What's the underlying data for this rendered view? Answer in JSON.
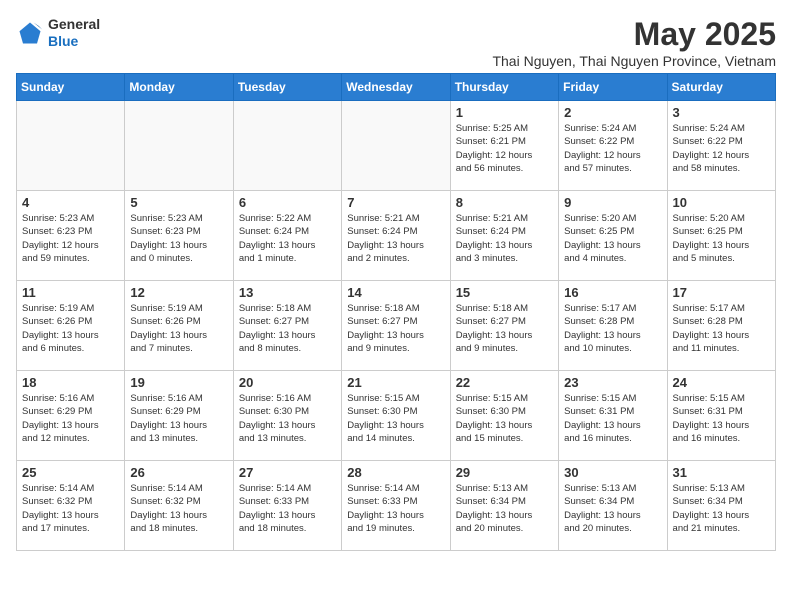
{
  "header": {
    "logo_general": "General",
    "logo_blue": "Blue",
    "month_title": "May 2025",
    "subtitle": "Thai Nguyen, Thai Nguyen Province, Vietnam"
  },
  "weekdays": [
    "Sunday",
    "Monday",
    "Tuesday",
    "Wednesday",
    "Thursday",
    "Friday",
    "Saturday"
  ],
  "weeks": [
    [
      {
        "day": "",
        "info": ""
      },
      {
        "day": "",
        "info": ""
      },
      {
        "day": "",
        "info": ""
      },
      {
        "day": "",
        "info": ""
      },
      {
        "day": "1",
        "info": "Sunrise: 5:25 AM\nSunset: 6:21 PM\nDaylight: 12 hours\nand 56 minutes."
      },
      {
        "day": "2",
        "info": "Sunrise: 5:24 AM\nSunset: 6:22 PM\nDaylight: 12 hours\nand 57 minutes."
      },
      {
        "day": "3",
        "info": "Sunrise: 5:24 AM\nSunset: 6:22 PM\nDaylight: 12 hours\nand 58 minutes."
      }
    ],
    [
      {
        "day": "4",
        "info": "Sunrise: 5:23 AM\nSunset: 6:23 PM\nDaylight: 12 hours\nand 59 minutes."
      },
      {
        "day": "5",
        "info": "Sunrise: 5:23 AM\nSunset: 6:23 PM\nDaylight: 13 hours\nand 0 minutes."
      },
      {
        "day": "6",
        "info": "Sunrise: 5:22 AM\nSunset: 6:24 PM\nDaylight: 13 hours\nand 1 minute."
      },
      {
        "day": "7",
        "info": "Sunrise: 5:21 AM\nSunset: 6:24 PM\nDaylight: 13 hours\nand 2 minutes."
      },
      {
        "day": "8",
        "info": "Sunrise: 5:21 AM\nSunset: 6:24 PM\nDaylight: 13 hours\nand 3 minutes."
      },
      {
        "day": "9",
        "info": "Sunrise: 5:20 AM\nSunset: 6:25 PM\nDaylight: 13 hours\nand 4 minutes."
      },
      {
        "day": "10",
        "info": "Sunrise: 5:20 AM\nSunset: 6:25 PM\nDaylight: 13 hours\nand 5 minutes."
      }
    ],
    [
      {
        "day": "11",
        "info": "Sunrise: 5:19 AM\nSunset: 6:26 PM\nDaylight: 13 hours\nand 6 minutes."
      },
      {
        "day": "12",
        "info": "Sunrise: 5:19 AM\nSunset: 6:26 PM\nDaylight: 13 hours\nand 7 minutes."
      },
      {
        "day": "13",
        "info": "Sunrise: 5:18 AM\nSunset: 6:27 PM\nDaylight: 13 hours\nand 8 minutes."
      },
      {
        "day": "14",
        "info": "Sunrise: 5:18 AM\nSunset: 6:27 PM\nDaylight: 13 hours\nand 9 minutes."
      },
      {
        "day": "15",
        "info": "Sunrise: 5:18 AM\nSunset: 6:27 PM\nDaylight: 13 hours\nand 9 minutes."
      },
      {
        "day": "16",
        "info": "Sunrise: 5:17 AM\nSunset: 6:28 PM\nDaylight: 13 hours\nand 10 minutes."
      },
      {
        "day": "17",
        "info": "Sunrise: 5:17 AM\nSunset: 6:28 PM\nDaylight: 13 hours\nand 11 minutes."
      }
    ],
    [
      {
        "day": "18",
        "info": "Sunrise: 5:16 AM\nSunset: 6:29 PM\nDaylight: 13 hours\nand 12 minutes."
      },
      {
        "day": "19",
        "info": "Sunrise: 5:16 AM\nSunset: 6:29 PM\nDaylight: 13 hours\nand 13 minutes."
      },
      {
        "day": "20",
        "info": "Sunrise: 5:16 AM\nSunset: 6:30 PM\nDaylight: 13 hours\nand 13 minutes."
      },
      {
        "day": "21",
        "info": "Sunrise: 5:15 AM\nSunset: 6:30 PM\nDaylight: 13 hours\nand 14 minutes."
      },
      {
        "day": "22",
        "info": "Sunrise: 5:15 AM\nSunset: 6:30 PM\nDaylight: 13 hours\nand 15 minutes."
      },
      {
        "day": "23",
        "info": "Sunrise: 5:15 AM\nSunset: 6:31 PM\nDaylight: 13 hours\nand 16 minutes."
      },
      {
        "day": "24",
        "info": "Sunrise: 5:15 AM\nSunset: 6:31 PM\nDaylight: 13 hours\nand 16 minutes."
      }
    ],
    [
      {
        "day": "25",
        "info": "Sunrise: 5:14 AM\nSunset: 6:32 PM\nDaylight: 13 hours\nand 17 minutes."
      },
      {
        "day": "26",
        "info": "Sunrise: 5:14 AM\nSunset: 6:32 PM\nDaylight: 13 hours\nand 18 minutes."
      },
      {
        "day": "27",
        "info": "Sunrise: 5:14 AM\nSunset: 6:33 PM\nDaylight: 13 hours\nand 18 minutes."
      },
      {
        "day": "28",
        "info": "Sunrise: 5:14 AM\nSunset: 6:33 PM\nDaylight: 13 hours\nand 19 minutes."
      },
      {
        "day": "29",
        "info": "Sunrise: 5:13 AM\nSunset: 6:34 PM\nDaylight: 13 hours\nand 20 minutes."
      },
      {
        "day": "30",
        "info": "Sunrise: 5:13 AM\nSunset: 6:34 PM\nDaylight: 13 hours\nand 20 minutes."
      },
      {
        "day": "31",
        "info": "Sunrise: 5:13 AM\nSunset: 6:34 PM\nDaylight: 13 hours\nand 21 minutes."
      }
    ]
  ]
}
